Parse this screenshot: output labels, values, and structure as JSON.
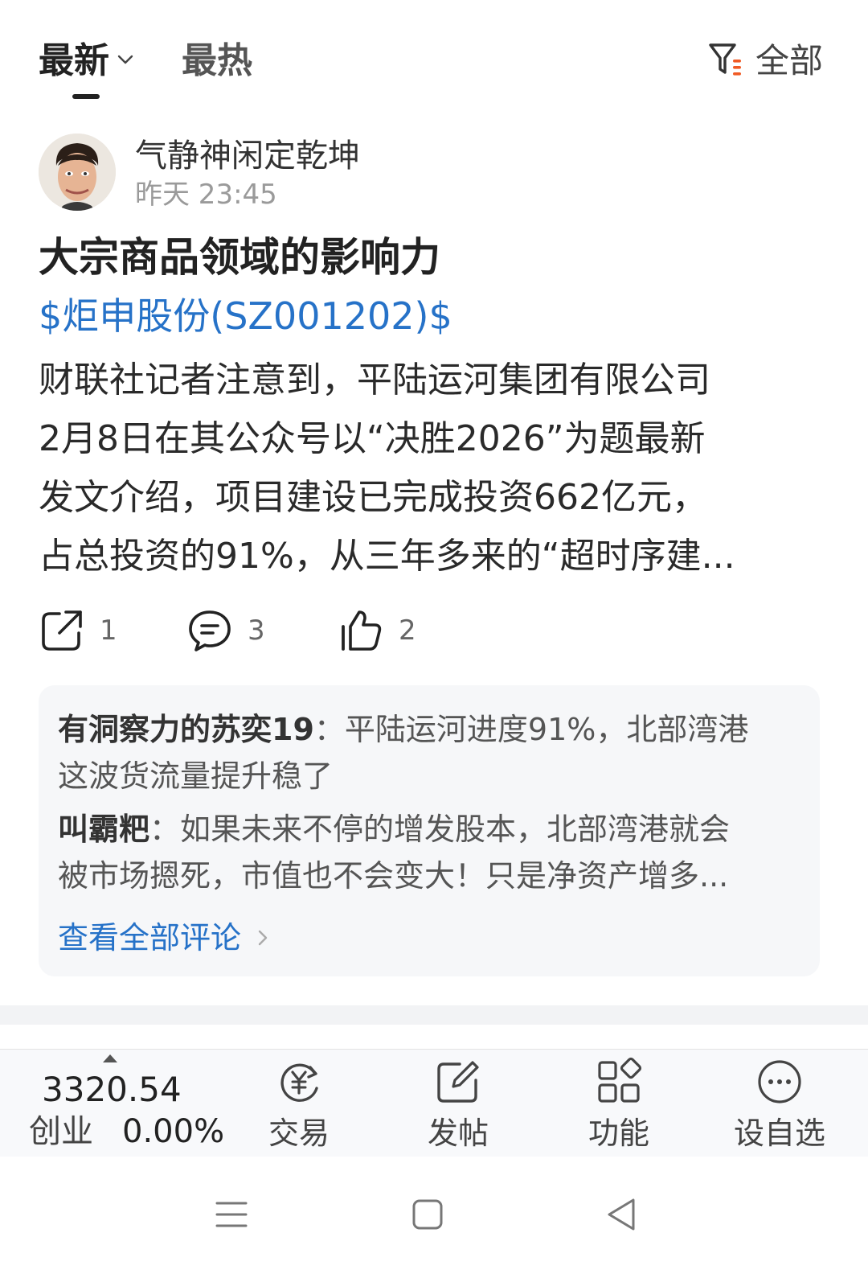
{
  "tabs": {
    "latest": "最新",
    "hot": "最热",
    "filter": "全部"
  },
  "post": {
    "author": "气静神闲定乾坤",
    "time": "昨天 23:45",
    "title": "大宗商品领域的影响力",
    "stock_tag": "$炬申股份(SZ001202)$",
    "body_lines": [
      "财联社记者注意到，平陆运河集团有限公司",
      "2月8日在其公众号以“决胜2026”为题最新",
      "发文介绍，项目建设已完成投资662亿元，",
      "占总投资的91%，从三年多来的“超时序建..."
    ],
    "share_count": "1",
    "comment_count": "3",
    "like_count": "2"
  },
  "comments": {
    "items": [
      {
        "user": "有洞察力的苏奕19",
        "text_line1": "：平陆运河进度91%，北部湾港",
        "text_line2": "这波货流量提升稳了"
      },
      {
        "user": "叫霸粑",
        "text_line1": "：如果未来不停的增发股本，北部湾港就会",
        "text_line2": "被市场摁死，市值也不会变大！只是净资产增多..."
      }
    ],
    "view_all": "查看全部评论"
  },
  "bottom_bar": {
    "index_value": "3320.54",
    "index_name": "创业",
    "index_change": "0.00%",
    "nav": [
      {
        "label": "交易",
        "icon": "yuan-exchange-icon"
      },
      {
        "label": "发帖",
        "icon": "edit-post-icon"
      },
      {
        "label": "功能",
        "icon": "grid-apps-icon"
      },
      {
        "label": "设自选",
        "icon": "more-dots-icon"
      }
    ]
  },
  "colors": {
    "link": "#2672c8",
    "accent_orange": "#f05a24",
    "text_primary": "#222222",
    "text_secondary": "#9a9a9a"
  }
}
